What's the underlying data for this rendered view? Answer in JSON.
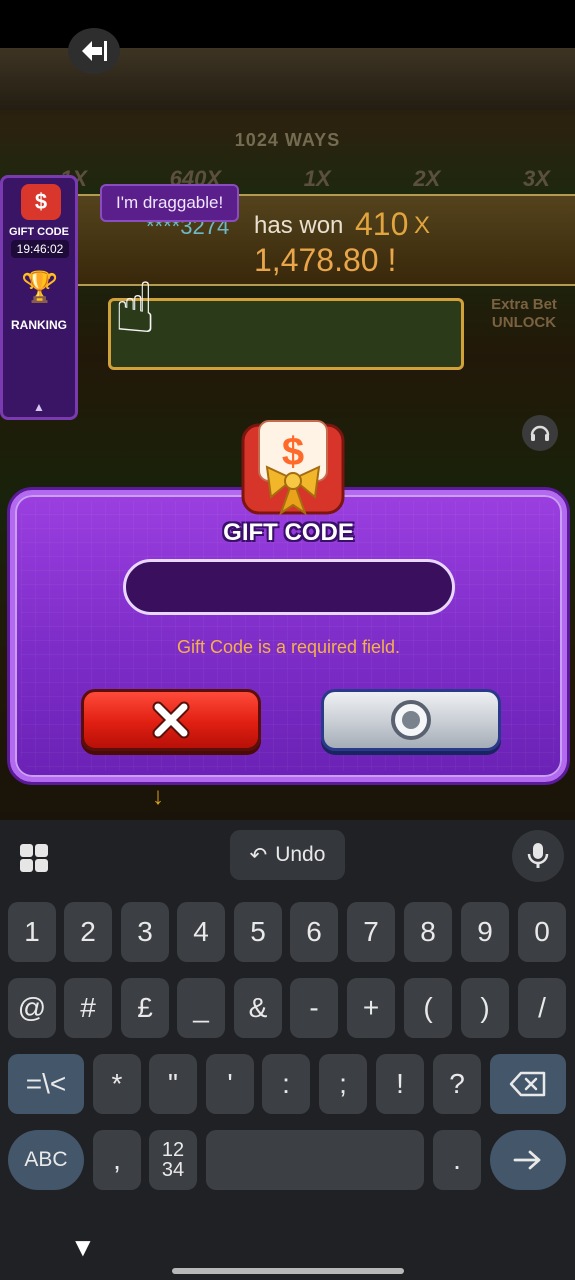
{
  "game": {
    "ways_label": "1024 WAYS",
    "multipliers": [
      "1X",
      "640X",
      "1X",
      "2X",
      "3X"
    ],
    "win": {
      "user": "****3274",
      "text": "has won",
      "multiplier": "410",
      "multiplier_suffix": "X",
      "amount": "1,478.80 !"
    },
    "draggable_tip": "I'm draggable!",
    "extra_bet": "Extra Bet UNLOCK",
    "side_panel": {
      "gift_code_label": "GIFT CODE",
      "timer": "19:46:02",
      "ranking_label": "RANKING"
    }
  },
  "dialog": {
    "title": "GIFT CODE",
    "input_value": "",
    "error": "Gift Code is a required field.",
    "cancel_icon": "close-icon",
    "confirm_icon": "circle-icon"
  },
  "keyboard": {
    "toolbar": {
      "undo_label": "Undo"
    },
    "row1": [
      "1",
      "2",
      "3",
      "4",
      "5",
      "6",
      "7",
      "8",
      "9",
      "0"
    ],
    "row2": [
      "@",
      "#",
      "£",
      "_",
      "&",
      "-",
      "+",
      "(",
      ")",
      "/"
    ],
    "row3": [
      "=\\<",
      "*",
      "\"",
      "'",
      ":",
      ";",
      "!",
      "?"
    ],
    "row4": {
      "abc": "ABC",
      "comma": ",",
      "numpad_top": "12",
      "numpad_bottom": "34",
      "period": "."
    }
  },
  "colors": {
    "dialog_purple": "#7d2cc8",
    "error_orange": "#f5b24a",
    "cancel_red": "#e01f12",
    "keyboard_bg": "#1f2124"
  }
}
